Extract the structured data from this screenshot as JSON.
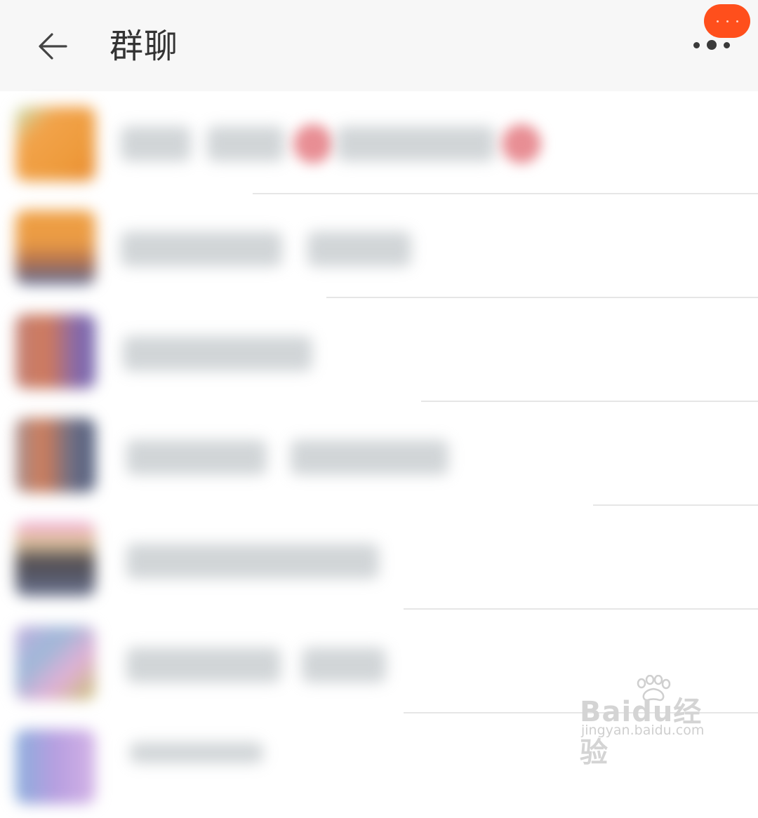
{
  "header": {
    "title": "群聊",
    "back_icon": "back-arrow-icon",
    "more_icon": "more-dots-icon",
    "badge_color": "#ff4f1c"
  },
  "list": {
    "item_count_visible": 7
  },
  "watermark": {
    "brand_text": "Baidu经验",
    "url": "jingyan.baidu.com"
  }
}
